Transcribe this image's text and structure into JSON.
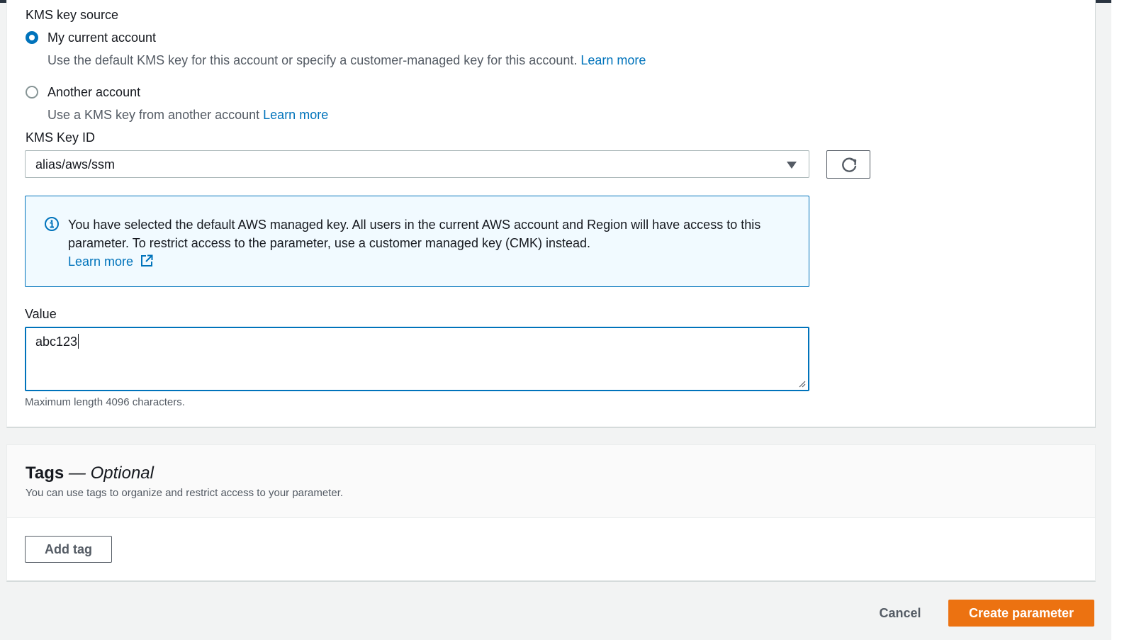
{
  "encryption": {
    "kms_key_source_label": "KMS key source",
    "options": [
      {
        "label": "My current account",
        "description": "Use the default KMS key for this account or specify a customer-managed key for this account.",
        "link": "Learn more",
        "selected": true
      },
      {
        "label": "Another account",
        "description": "Use a KMS key from another account",
        "link": "Learn more",
        "selected": false
      }
    ],
    "kms_key_id_label": "KMS Key ID",
    "kms_key_id_value": "alias/aws/ssm"
  },
  "info_alert": {
    "message": "You have selected the default AWS managed key. All users in the current AWS account and Region will have access to this parameter. To restrict access to the parameter, use a customer managed key (CMK) instead.",
    "link": "Learn more"
  },
  "value_field": {
    "label": "Value",
    "value": "abc123",
    "hint": "Maximum length 4096 characters."
  },
  "tags": {
    "title": "Tags",
    "optional": "— Optional",
    "description": "You can use tags to organize and restrict access to your parameter.",
    "add_button": "Add tag"
  },
  "footer": {
    "cancel": "Cancel",
    "create": "Create parameter"
  },
  "colors": {
    "primary": "#ec7211",
    "link": "#0073bb",
    "info_bg": "#f1faff"
  }
}
